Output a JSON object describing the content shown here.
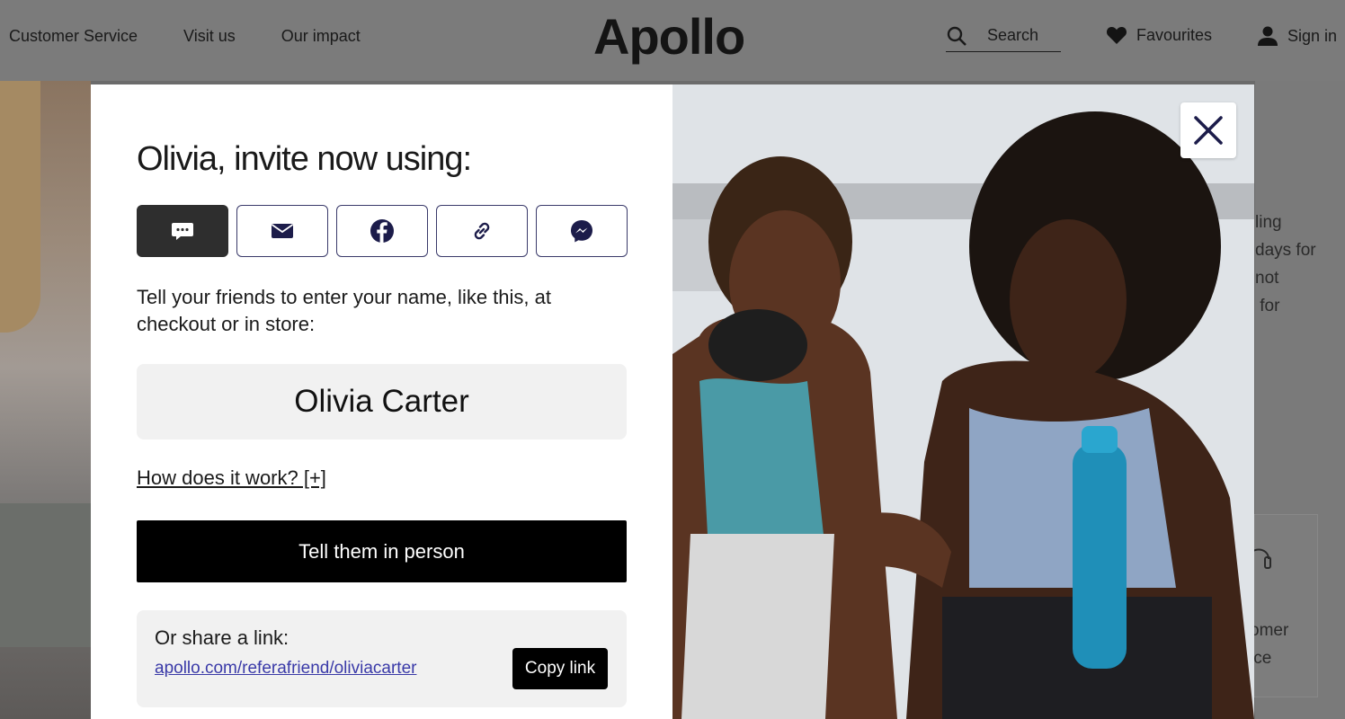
{
  "header": {
    "nav": [
      "Customer Service",
      "Visit us",
      "Our impact"
    ],
    "brand": "Apollo",
    "search_label": "Search",
    "favourites_label": "Favourites",
    "signin_label": "Sign in"
  },
  "background": {
    "right_text": "ling\ndays for\nnot\n for",
    "card_text": "omer\nice"
  },
  "modal": {
    "title": "Olivia, invite now using:",
    "share_options": [
      {
        "icon": "sms-icon",
        "active": true
      },
      {
        "icon": "email-icon",
        "active": false
      },
      {
        "icon": "facebook-icon",
        "active": false
      },
      {
        "icon": "link-icon",
        "active": false
      },
      {
        "icon": "messenger-icon",
        "active": false
      }
    ],
    "instruction": "Tell your friends to enter your name, like this, at checkout or in store:",
    "referral_name": "Olivia Carter",
    "how_link": "How does it work? [+]",
    "tell_button": "Tell them in person",
    "share_link_label": "Or share a link:",
    "share_link_url": "apollo.com/referafriend/oliviacarter",
    "copy_button": "Copy link"
  },
  "colors": {
    "overlay_bg": "#7b7b7b",
    "panel_bg": "#ffffff",
    "button_dark": "#000000",
    "link_blue": "#3a3aa8",
    "share_border": "#3a3a6a"
  }
}
